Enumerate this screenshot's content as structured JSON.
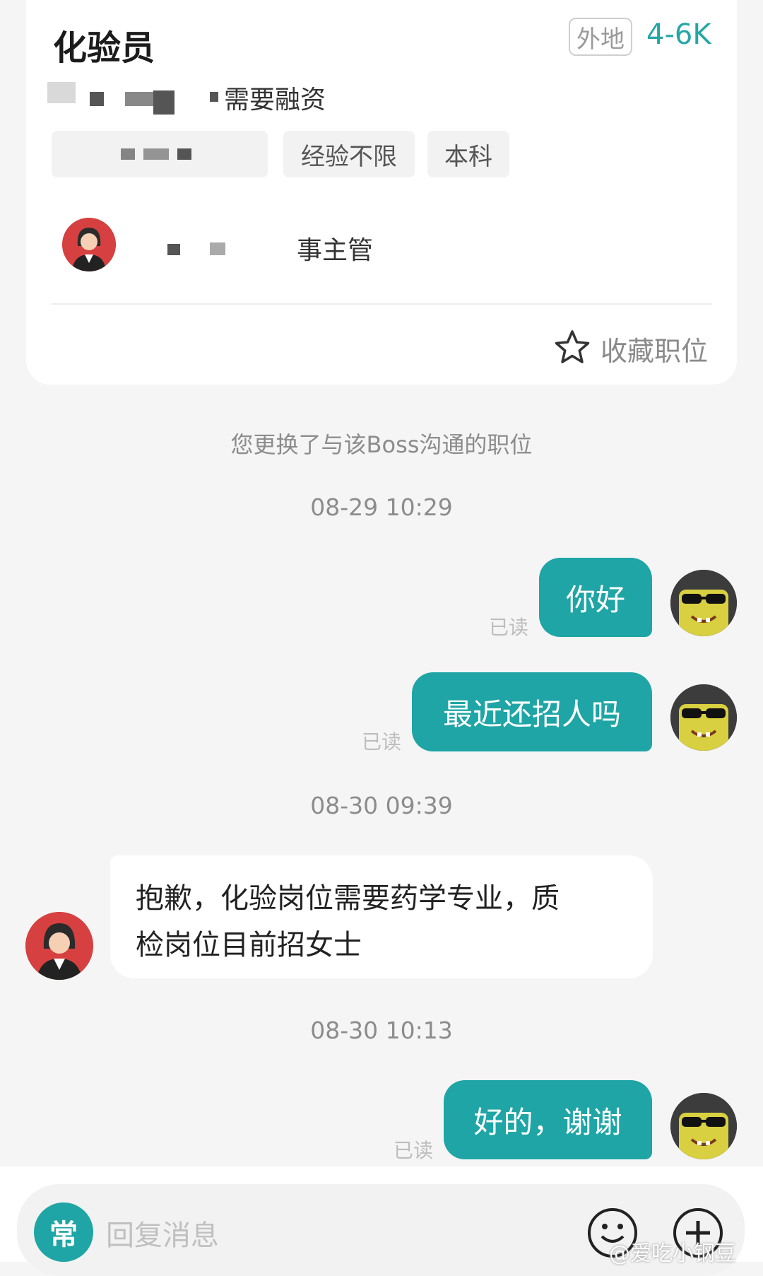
{
  "job": {
    "title": "化验员",
    "location_badge": "外地",
    "salary": "4-6K",
    "company_visible_text": "需要融资",
    "tags": [
      "经验不限",
      "本科"
    ],
    "hr_visible_text": "事主管",
    "favorite_label": "收藏职位"
  },
  "chat": {
    "system_notice": "您更换了与该Boss沟通的职位",
    "timestamps": [
      "08-29 10:29",
      "08-30 09:39",
      "08-30 10:13"
    ],
    "messages": [
      {
        "text": "你好",
        "status": "已读"
      },
      {
        "text": "最近还招人吗",
        "status": "已读"
      },
      {
        "line1": "抱歉，化验岗位需要药学专业，质",
        "line2": "检岗位目前招女士"
      },
      {
        "text": "好的，谢谢",
        "status": "已读"
      }
    ]
  },
  "input_bar": {
    "common_button_label": "常",
    "placeholder": "回复消息"
  },
  "watermark": "@爱吃小钢豆",
  "colors": {
    "accent": "#1fa5a5",
    "salary": "#25a6a6",
    "background": "#f5f5f5"
  }
}
